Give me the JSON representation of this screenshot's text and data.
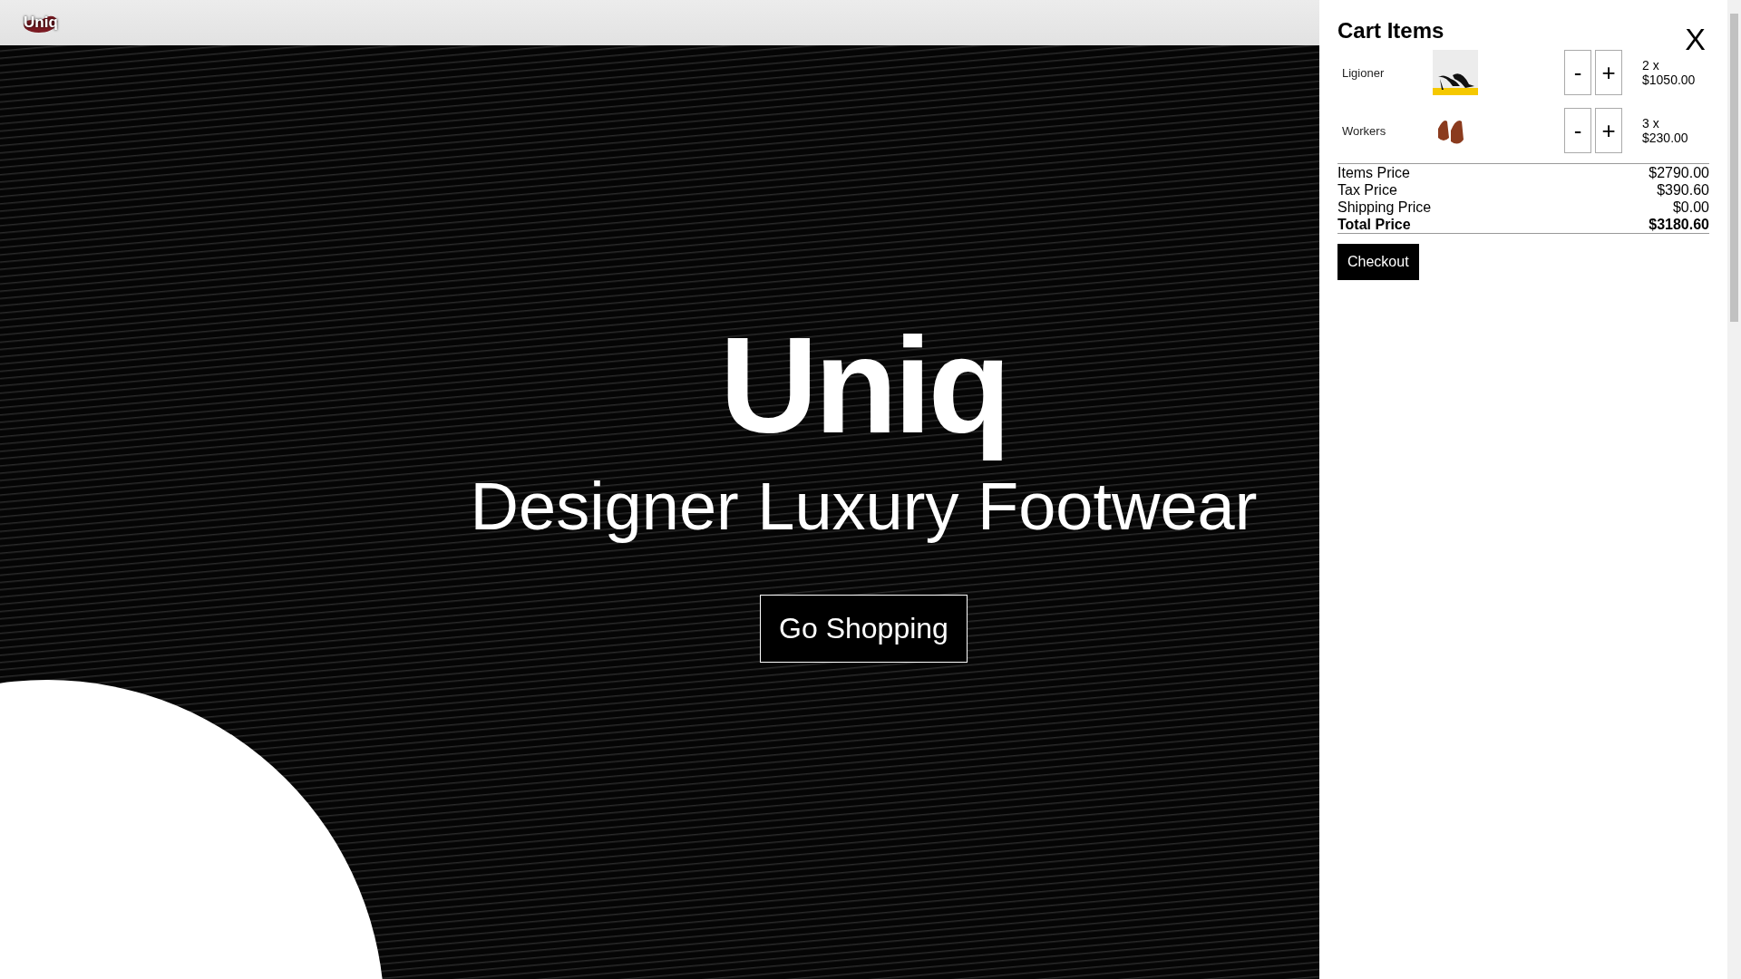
{
  "header": {
    "logo": "Uniq"
  },
  "hero": {
    "title": "Uniq",
    "subtitle": "Designer Luxury Footwear",
    "button": "Go Shopping"
  },
  "cart": {
    "title": "Cart Items",
    "close": "X",
    "items": [
      {
        "name": "Ligioner",
        "kind": "heels",
        "minus": "-",
        "plus": "+",
        "quantity": "2 x",
        "price": "$1050.00"
      },
      {
        "name": "Workers",
        "kind": "brogues",
        "minus": "-",
        "plus": "+",
        "quantity": "3 x",
        "price": "$230.00"
      }
    ],
    "summary": [
      {
        "kind": "line",
        "label": "Items Price",
        "value": "$2790.00"
      },
      {
        "kind": "line",
        "label": "Tax Price",
        "value": "$390.60"
      },
      {
        "kind": "line",
        "label": "Shipping Price",
        "value": "$0.00"
      },
      {
        "kind": "total",
        "label": "Total Price",
        "value": "$3180.60"
      }
    ],
    "checkout": "Checkout"
  }
}
